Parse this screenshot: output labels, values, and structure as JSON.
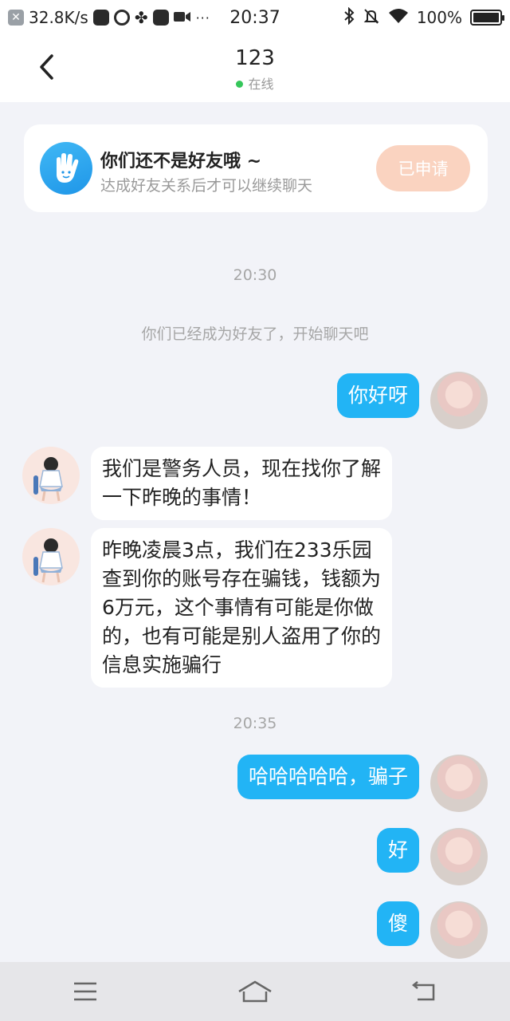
{
  "status_bar": {
    "speed": "32.8K/s",
    "time": "20:37",
    "battery": "100%",
    "dots": "···"
  },
  "header": {
    "title": "123",
    "status": "在线"
  },
  "friend_card": {
    "title": "你们还不是好友哦 ~",
    "subtitle": "达成好友关系后才可以继续聊天",
    "button": "已申请"
  },
  "chat": {
    "timestamp_1": "20:30",
    "system_message": "你们已经成为好友了，开始聊天吧",
    "msg_1": "你好呀",
    "msg_2_line1": "我们是警务人员，现在找你了解",
    "msg_2_line2": "一下昨晚的事情！",
    "msg_3_line1": "昨晚凌晨3点，我们在233乐园",
    "msg_3_line2": "查到你的账号存在骗钱，钱额为",
    "msg_3_line3": "6万元，这个事情有可能是你做",
    "msg_3_line4": "的，也有可能是别人盗用了你的",
    "msg_3_line5": "信息实施骗行",
    "timestamp_2": "20:35",
    "msg_4": "哈哈哈哈哈，骗子",
    "msg_5": "好",
    "msg_6": "傻"
  },
  "colors": {
    "my_bubble": "#22b4f5",
    "button_disabled": "#fad3c0",
    "online": "#35c65a"
  }
}
